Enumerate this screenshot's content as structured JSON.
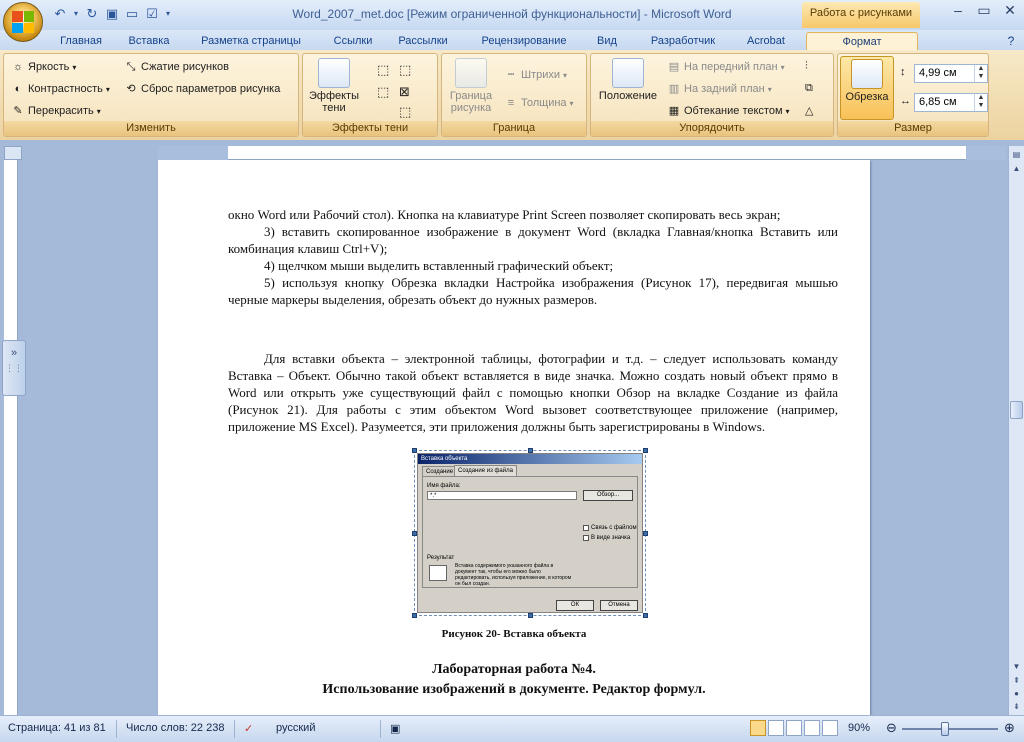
{
  "titlebar": {
    "title": "Word_2007_met.doc [Режим ограниченной функциональности] - Microsoft Word",
    "context_tab": "Работа с рисунками"
  },
  "tabs": [
    "Главная",
    "Вставка",
    "Разметка страницы",
    "Ссылки",
    "Рассылки",
    "Рецензирование",
    "Вид",
    "Разработчик",
    "Acrobat",
    "Формат"
  ],
  "active_tab": "Формат",
  "ribbon": {
    "izmenit": {
      "label": "Изменить",
      "brightness": "Яркость",
      "contrast": "Контрастность",
      "recolor": "Перекрасить",
      "compress": "Сжатие рисунков",
      "reset": "Сброс параметров рисунка"
    },
    "shadow": {
      "label": "Эффекты тени",
      "btn": "Эффекты тени"
    },
    "border": {
      "label": "Граница",
      "btn": "Граница рисунка",
      "dashes": "Штрихи",
      "weight": "Толщина"
    },
    "arrange": {
      "label": "Упорядочить",
      "position": "Положение",
      "front": "На передний план",
      "back": "На задний план",
      "wrap": "Обтекание текстом"
    },
    "size": {
      "label": "Размер",
      "crop": "Обрезка",
      "height": "4,99 см",
      "width": "6,85 см"
    }
  },
  "document": {
    "p1": "окно Word или Рабочий стол). Кнопка на клавиатуре Print Screen позволяет скопировать весь экран;",
    "p2": "3) вставить скопированное изображение в документ Word (вкладка Главная/кнопка Вставить или комбинация клавиш Ctrl+V);",
    "p3": "4) щелчком мыши выделить вставленный графический объект;",
    "p4": "5) используя кнопку Обрезка вкладки Настройка изображения (Рисунок 17), передвигая мышью черные маркеры выделения, обрезать объект до нужных размеров.",
    "p5": "Для вставки объекта – электронной таблицы, фотографии и т.д. – следует использовать команду Вставка – Объект. Обычно такой объект вставляется в виде значка. Можно создать новый объект прямо в Word или открыть уже существующий файл с помощью кнопки Обзор на вкладке Создание из файла (Рисунок 21). Для работы с этим объектом Word вызовет соответствующее приложение (например, приложение MS Excel). Разумеется, эти приложения должны быть зарегистрированы в Windows.",
    "caption": "Рисунок 20- Вставка объекта",
    "heading1": "Лабораторная работа №4.",
    "heading2": "Использование изображений в документе. Редактор формул."
  },
  "dialog": {
    "title": "Вставка объекта",
    "tab1": "Создание",
    "tab2": "Создание из файла",
    "filename_label": "Имя файла:",
    "filename_value": "*.*",
    "browse": "Обзор...",
    "link": "Связь с файлом",
    "as_icon": "В виде значка",
    "result_label": "Результат",
    "result_text": "Вставка содержимого указанного файла в документ так, чтобы его можно было редактировать, используя приложение, в котором он был создан.",
    "ok": "ОК",
    "cancel": "Отмена"
  },
  "status": {
    "page": "Страница: 41 из 81",
    "words": "Число слов: 22 238",
    "lang": "русский",
    "zoom": "90%"
  }
}
